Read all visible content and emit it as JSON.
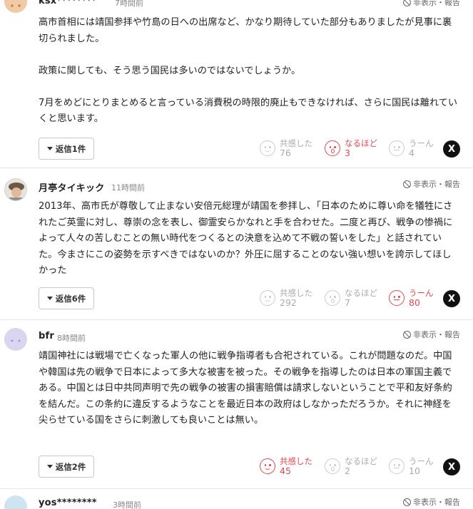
{
  "comments": [
    {
      "user": "ksx********",
      "time": "7時間前",
      "report": "非表示・報告",
      "paragraphs": [
        "高市首相には靖国参拝や竹島の日への出席など、かなり期待していた部分もありましたが見事に裏切られました。",
        "政策に関しても、そう思う国民は多いのではないでしょうか。",
        "7月をめどにとりまとめると言っている消費税の時限的廃止もできなければ、さらに国民は離れていくと思います。"
      ],
      "reply": "返信1件",
      "reactions": [
        {
          "label": "共感した",
          "count": "76",
          "active": false
        },
        {
          "label": "なるほど",
          "count": "3",
          "active": true
        },
        {
          "label": "うーん",
          "count": "4",
          "active": false
        }
      ],
      "share": "X"
    },
    {
      "user": "月亭タイキック",
      "time": "11時間前",
      "report": "非表示・報告",
      "paragraphs": [
        "2013年、高市氏が尊敬して止まない安倍元総理が靖国を参拝し、「日本のために尊い命を犠牲にされたご英霊に対し、尊崇の念を表し、御霊安らかなれと手を合わせた。二度と再び、戦争の惨禍によって人々の苦しむことの無い時代をつくるとの決意を込めて不戦の誓いをした」と話されていた。今まさにこの姿勢を示すべきではないのか？外圧に屈することのない強い想いを誇示してほしかった"
      ],
      "reply": "返信6件",
      "reactions": [
        {
          "label": "共感した",
          "count": "292",
          "active": false
        },
        {
          "label": "なるほど",
          "count": "7",
          "active": false
        },
        {
          "label": "うーん",
          "count": "80",
          "active": true
        }
      ],
      "share": "X"
    },
    {
      "user": "bfr",
      "time": "8時間前",
      "report": "非表示・報告",
      "paragraphs": [
        "靖国神社には戦場で亡くなった軍人の他に戦争指導者も合祀されている。これが問題なのだ。中国や韓国は先の戦争で日本によって多大な被害を被った。その戦争を指導したのは日本の軍国主義である。中国とは日中共同声明で先の戦争の被害の損害賠償は請求しないということで平和友好条約を結んだ。この条約に違反するようなことを最近日本の政府はしなかっただろうか。それに神経を尖らせている国をさらに刺激しても良いことは無い。"
      ],
      "reply": "返信2件",
      "reactions": [
        {
          "label": "共感した",
          "count": "45",
          "active": true
        },
        {
          "label": "なるほど",
          "count": "2",
          "active": false
        },
        {
          "label": "うーん",
          "count": "10",
          "active": false
        }
      ],
      "share": "X"
    },
    {
      "user": "yos********",
      "time": "3時間前",
      "report": "非表示・報告"
    }
  ],
  "icons": {
    "report": "ban-icon",
    "reply": "caret-down-icon",
    "react1": "smile-face-icon",
    "react2": "surprised-face-icon",
    "react3": "hmm-face-icon",
    "share": "x-logo-icon"
  },
  "colors": {
    "accent": "#e0484e",
    "inactive": "#aaaaaa",
    "divider": "#e6e6e6"
  }
}
